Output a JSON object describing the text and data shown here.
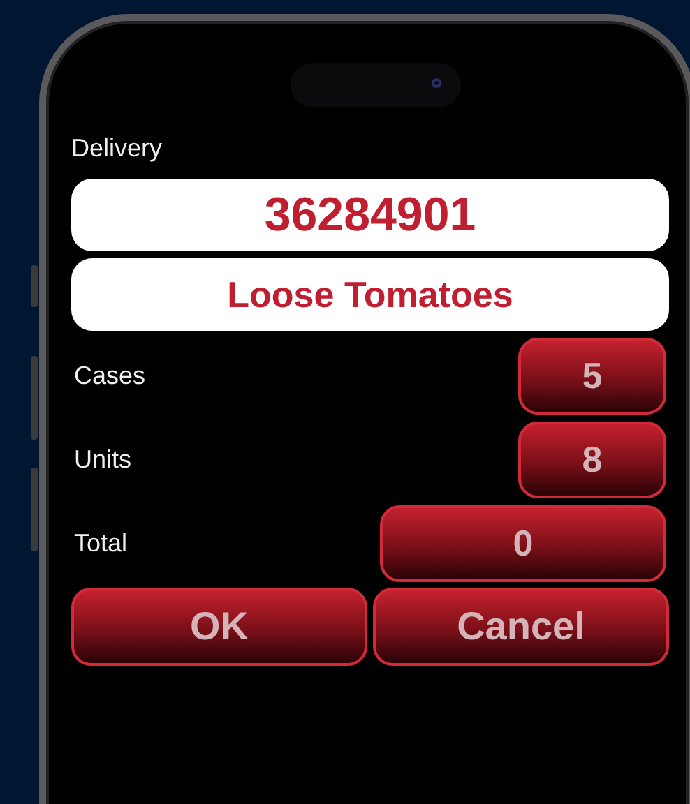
{
  "screen_title": "Delivery",
  "code": "36284901",
  "product": "Loose Tomatoes",
  "fields": [
    {
      "label": "Cases",
      "value": "5",
      "kind": "count"
    },
    {
      "label": "Units",
      "value": "8",
      "kind": "count"
    },
    {
      "label": "Total",
      "value": "0",
      "kind": "total"
    }
  ],
  "buttons": [
    "OK",
    "Cancel"
  ]
}
